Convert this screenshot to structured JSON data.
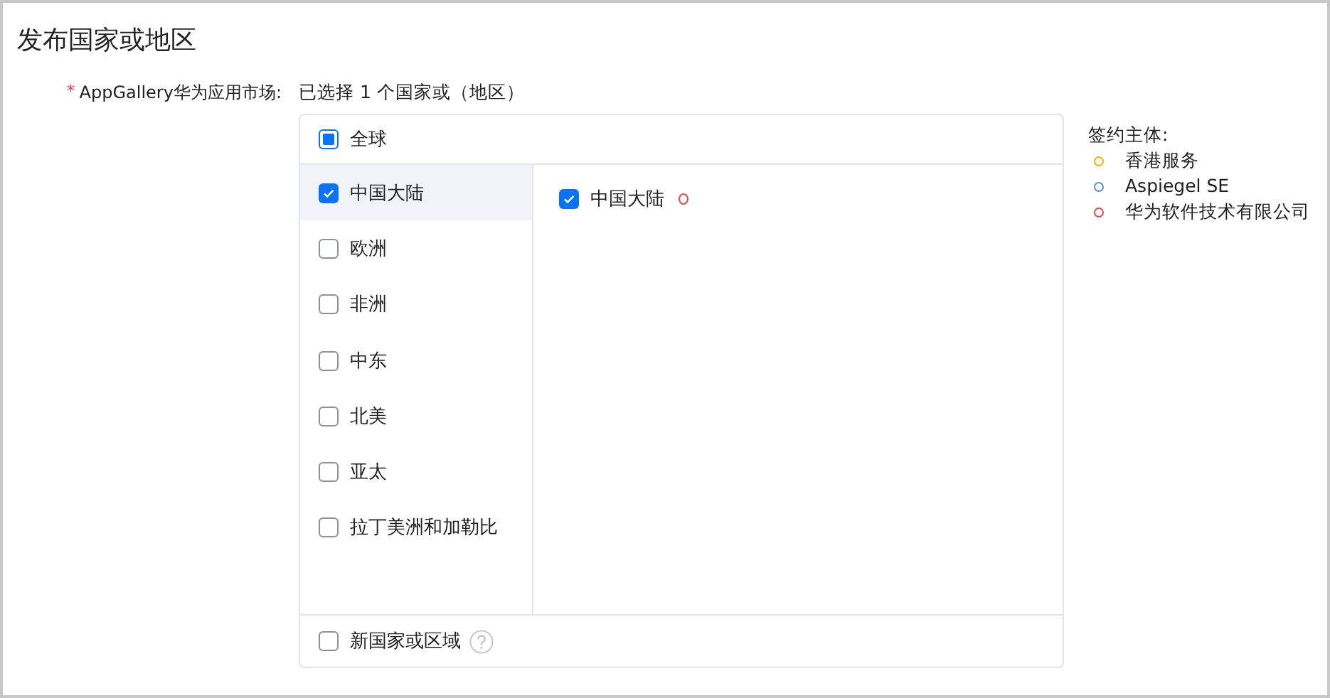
{
  "title": "发布国家或地区",
  "field": {
    "required_mark": "*",
    "label": "AppGallery华为应用市场:",
    "summary": "已选择 1 个国家或（地区）"
  },
  "global": {
    "label": "全球",
    "checked": false,
    "indeterminate": true
  },
  "regions": [
    {
      "label": "中国大陆",
      "checked": true,
      "selected": true
    },
    {
      "label": "欧洲",
      "checked": false,
      "selected": false
    },
    {
      "label": "非洲",
      "checked": false,
      "selected": false
    },
    {
      "label": "中东",
      "checked": false,
      "selected": false
    },
    {
      "label": "北美",
      "checked": false,
      "selected": false
    },
    {
      "label": "亚太",
      "checked": false,
      "selected": false
    },
    {
      "label": "拉丁美洲和加勒比",
      "checked": false,
      "selected": false
    }
  ],
  "countries": [
    {
      "label": "中国大陆",
      "checked": true,
      "color": "#e5484d"
    }
  ],
  "new_regions": {
    "label": "新国家或区域",
    "checked": false
  },
  "legend": {
    "title": "签约主体:",
    "items": [
      {
        "label": "香港服务",
        "color": "#f5b000"
      },
      {
        "label": "Aspiegel SE",
        "color": "#5b8fd6"
      },
      {
        "label": "华为软件技术有限公司",
        "color": "#e5484d"
      }
    ]
  }
}
